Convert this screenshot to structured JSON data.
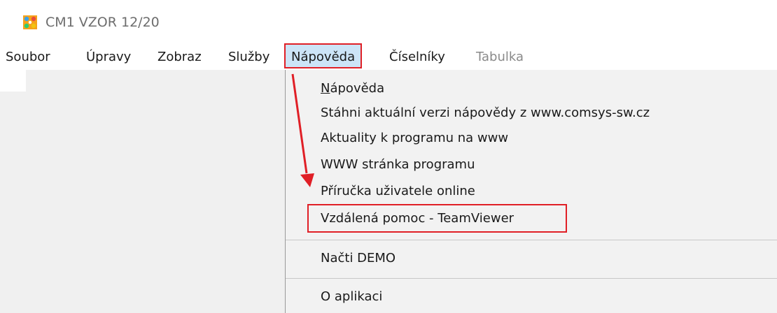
{
  "window": {
    "title": "CM1 VZOR 12/20",
    "icon": "app-grid-icon"
  },
  "menubar": {
    "items": [
      {
        "label": "Soubor"
      },
      {
        "label": "Úpravy"
      },
      {
        "label": "Zobraz"
      },
      {
        "label": "Služby"
      },
      {
        "label": "Nápověda"
      },
      {
        "label": "Číselníky"
      },
      {
        "label": "Tabulka"
      }
    ],
    "active_item": "Nápověda"
  },
  "dropdown": {
    "items": [
      {
        "label_underlined": "N",
        "label_rest": "ápověda"
      },
      {
        "label": "Stáhni aktuální verzi nápovědy z www.comsys-sw.cz"
      },
      {
        "label": "Aktuality k programu na www"
      },
      {
        "label": "WWW stránka programu"
      },
      {
        "label": "Příručka uživatele online"
      },
      {
        "label": "Vzdálená pomoc - TeamViewer"
      },
      {
        "label": "Načti DEMO"
      },
      {
        "label": "O aplikaci"
      }
    ]
  },
  "colors": {
    "highlight_border": "#e01f26",
    "menu_active_bg": "#cce4f7",
    "menu_bg": "#f2f2f2"
  }
}
